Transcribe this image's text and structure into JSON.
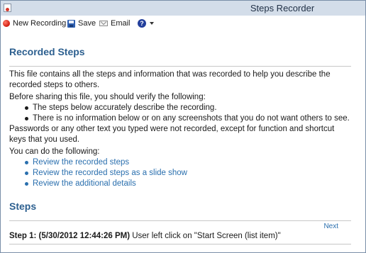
{
  "window": {
    "title": "Steps Recorder"
  },
  "toolbar": {
    "new_recording": "New Recording",
    "save": "Save",
    "email": "Email"
  },
  "recorded_steps": {
    "heading": "Recorded Steps",
    "intro": "This file contains all the steps and information that was recorded to help you describe the recorded steps to others.",
    "before_sharing": "Before sharing this file, you should verify the following:",
    "checks": [
      "The steps below accurately describe the recording.",
      "There is no information below or on any screenshots that you do not want others to see."
    ],
    "passwords_note": "Passwords or any other text you typed were not recorded, except for function and shortcut keys that you used.",
    "can_do": "You can do the following:",
    "links": [
      "Review the recorded steps",
      "Review the recorded steps as a slide show",
      "Review the additional details"
    ]
  },
  "steps": {
    "heading": "Steps",
    "next_label": "Next",
    "step1": {
      "label": "Step 1: (5/30/2012 12:44:26 PM)",
      "text": "User left click on \"Start Screen (list item)\""
    }
  },
  "colors": {
    "heading_blue": "#2c5f8f",
    "link_blue": "#2a6fae",
    "titlebar_bg": "#d3dde9"
  }
}
